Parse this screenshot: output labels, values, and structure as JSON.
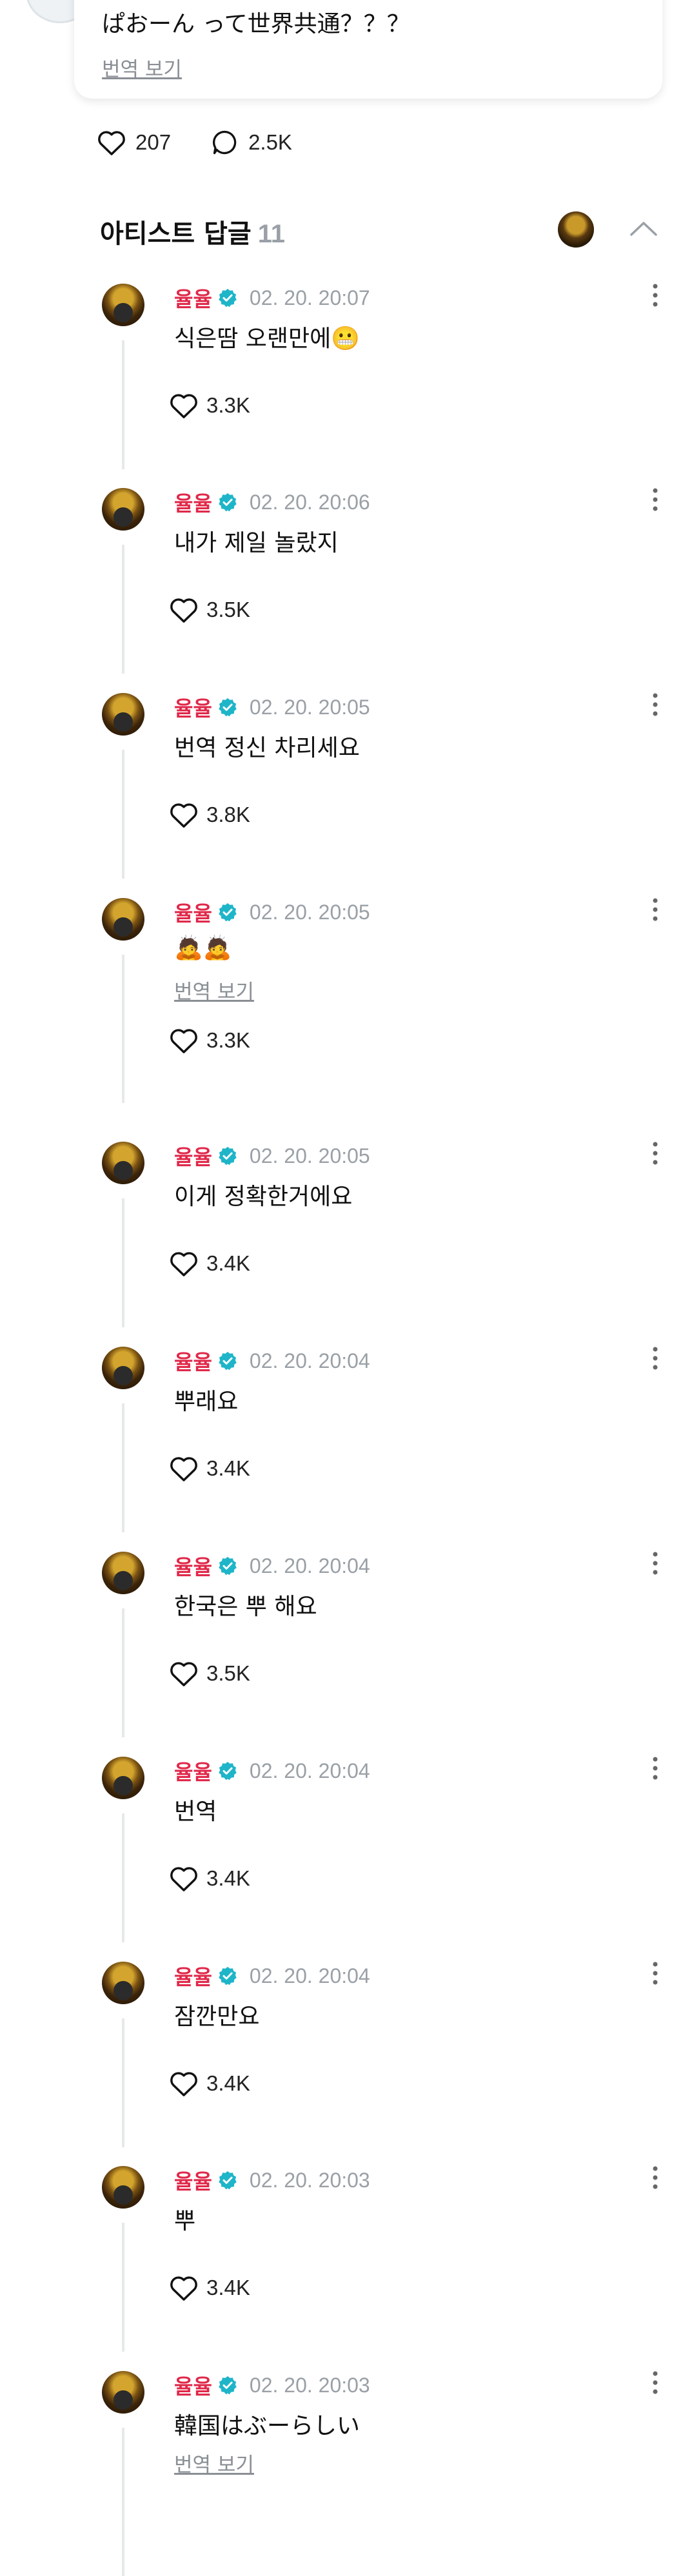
{
  "post": {
    "text": "ぱおーん って世界共通？？？",
    "translate_label": "번역 보기",
    "likes": "207",
    "comments": "2.5K"
  },
  "artist_replies": {
    "title": "아티스트 답글",
    "count": "11"
  },
  "comments": [
    {
      "name": "율율",
      "time": "02. 20. 20:07",
      "text": "식은땀 오랜만에😬",
      "likes": "3.3K",
      "translate": ""
    },
    {
      "name": "율율",
      "time": "02. 20. 20:06",
      "text": "내가 제일 놀랐지",
      "likes": "3.5K",
      "translate": ""
    },
    {
      "name": "율율",
      "time": "02. 20. 20:05",
      "text": "번역 정신 차리세요",
      "likes": "3.8K",
      "translate": ""
    },
    {
      "name": "율율",
      "time": "02. 20. 20:05",
      "text": "🙇🙇",
      "likes": "3.3K",
      "translate": "번역 보기"
    },
    {
      "name": "율율",
      "time": "02. 20. 20:05",
      "text": "이게 정확한거에요",
      "likes": "3.4K",
      "translate": ""
    },
    {
      "name": "율율",
      "time": "02. 20. 20:04",
      "text": "뿌래요",
      "likes": "3.4K",
      "translate": ""
    },
    {
      "name": "율율",
      "time": "02. 20. 20:04",
      "text": "한국은 뿌 해요",
      "likes": "3.5K",
      "translate": ""
    },
    {
      "name": "율율",
      "time": "02. 20. 20:04",
      "text": "번역",
      "likes": "3.4K",
      "translate": ""
    },
    {
      "name": "율율",
      "time": "02. 20. 20:04",
      "text": "잠깐만요",
      "likes": "3.4K",
      "translate": ""
    },
    {
      "name": "율율",
      "time": "02. 20. 20:03",
      "text": "뿌",
      "likes": "3.4K",
      "translate": ""
    },
    {
      "name": "율율",
      "time": "02. 20. 20:03",
      "text": "韓国はぶーらしい",
      "likes": "",
      "translate": "번역 보기"
    }
  ],
  "icons": {
    "heart": "heart-icon",
    "comment": "comment-bubble-icon",
    "verified": "verified-badge-icon",
    "more": "more-vertical-icon",
    "chevron": "chevron-up-icon"
  },
  "colors": {
    "artist_name": "#e0284a",
    "verified": "#1fb5c9",
    "muted": "#9aa0a6"
  }
}
